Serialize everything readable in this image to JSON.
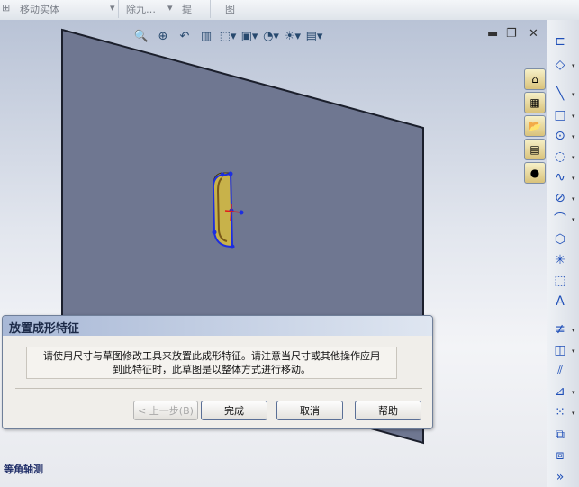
{
  "top_toolbar": {
    "move_body": "移动实体",
    "item2": "除九…",
    "item3": "提",
    "item4": "图"
  },
  "view_toolbar": {
    "icons": [
      "zoom-fit-icon",
      "zoom-area-icon",
      "previous-view-icon",
      "section-view-icon",
      "view-orientation-icon",
      "display-style-icon",
      "hide-show-icon",
      "appearance-icon",
      "scene-icon"
    ]
  },
  "dialog": {
    "title": "放置成形特征",
    "message_line1": "请使用尺寸与草图修改工具来放置此成形特征。请注意当尺寸或其他操作应用",
    "message_line2": "到此特征时，此草图是以整体方式进行移动。",
    "prev_label": "< 上一步(B)",
    "finish_label": "完成",
    "cancel_label": "取消",
    "help_label": "帮助"
  },
  "view_name": "等角轴测",
  "colors": {
    "plane": "#6f7791",
    "sketch_blue": "#1d2ee0",
    "feature_yellow": "#c8b24a"
  }
}
